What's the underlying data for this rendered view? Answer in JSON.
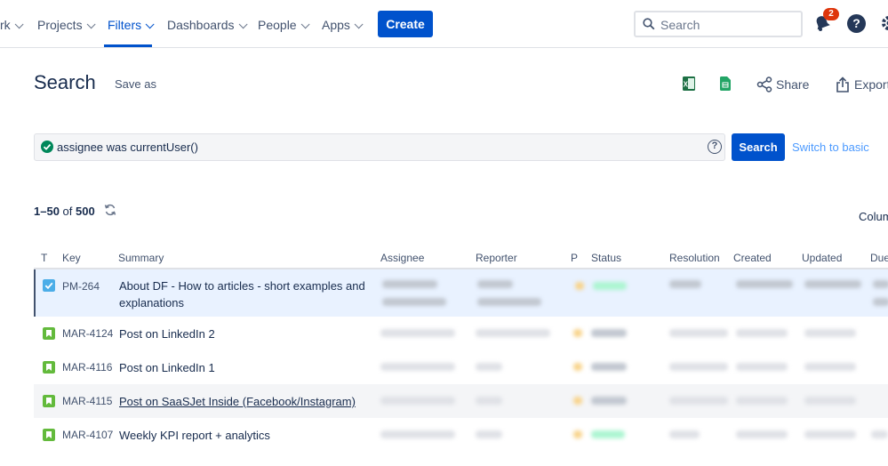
{
  "nav": {
    "items": [
      "rk",
      "Projects",
      "Filters",
      "Dashboards",
      "People",
      "Apps"
    ],
    "create_label": "Create",
    "search_placeholder": "Search",
    "notification_count": "2",
    "help_glyph": "?",
    "icons": [
      "search-icon",
      "bell-icon",
      "help-icon",
      "gear-icon"
    ],
    "accent_color": "#0052cc"
  },
  "header": {
    "title": "Search",
    "save_as": "Save as",
    "share": "Share",
    "export": "Export",
    "icons": [
      "excel-icon",
      "google-sheets-icon",
      "share-icon",
      "export-icon"
    ]
  },
  "query": {
    "jql": "assignee was currentUser()",
    "help_glyph": "?",
    "search_button": "Search",
    "switch_label": "Switch to basic"
  },
  "results": {
    "range": "1–50",
    "of_label": "of",
    "total": "500",
    "columns_label": "Colum"
  },
  "table": {
    "headers": [
      "T",
      "Key",
      "Summary",
      "Assignee",
      "Reporter",
      "P",
      "Status",
      "Resolution",
      "Created",
      "Updated",
      "Due"
    ],
    "rows": [
      {
        "key": "PM-264",
        "summary": "About DF - How to articles - short examples and explanations",
        "type_color": "#4bade8",
        "type_icon": "task-checkbox-icon"
      },
      {
        "key": "MAR-4124",
        "summary": "Post on LinkedIn 2",
        "type_color": "#63ba3c",
        "type_icon": "story-icon"
      },
      {
        "key": "MAR-4116",
        "summary": "Post on LinkedIn 1",
        "type_color": "#63ba3c",
        "type_icon": "story-icon"
      },
      {
        "key": "MAR-4115",
        "summary": "Post on SaaSJet Inside (Facebook/Instagram)",
        "type_color": "#63ba3c",
        "type_icon": "story-icon"
      },
      {
        "key": "MAR-4107",
        "summary": "Weekly KPI report + analytics",
        "type_color": "#63ba3c",
        "type_icon": "story-icon"
      }
    ]
  }
}
